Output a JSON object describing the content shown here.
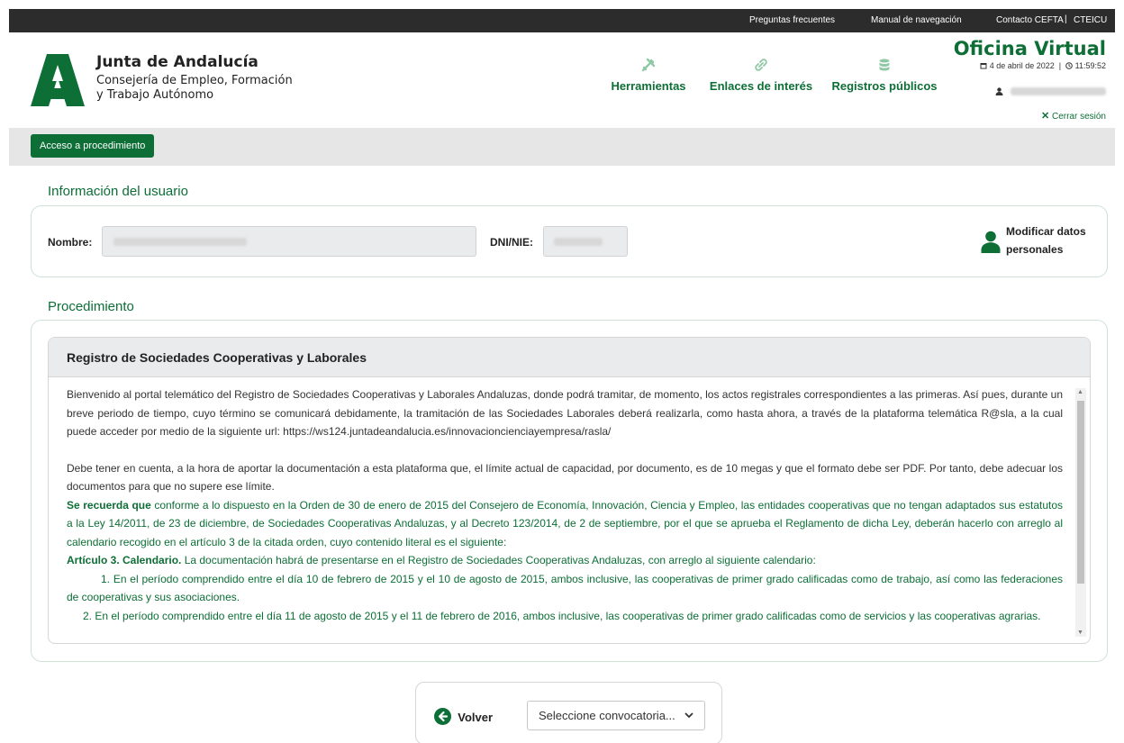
{
  "topbar": {
    "faq": "Preguntas frecuentes",
    "manual": "Manual de navegación",
    "contact": "Contacto CEFTA",
    "separator": "|",
    "cteicu": "CTEICU"
  },
  "header": {
    "org_title": "Junta de Andalucía",
    "org_sub_line1": "Consejería de Empleo, Formación",
    "org_sub_line2": "y Trabajo Autónomo",
    "nav": [
      {
        "label": "Herramientas",
        "icon": "tools-icon"
      },
      {
        "label": "Enlaces de interés",
        "icon": "link-icon"
      },
      {
        "label": "Registros públicos",
        "icon": "database-icon"
      }
    ],
    "office_title": "Oficina Virtual",
    "date": "4 de abril de 2022",
    "time": "11:59:52",
    "logout": "Cerrar sesión"
  },
  "toolbar": {
    "access_button": "Acceso a procedimiento"
  },
  "user_info": {
    "section_title": "Información del usuario",
    "name_label": "Nombre:",
    "dni_label": "DNI/NIE:",
    "modify_line1": "Modificar datos",
    "modify_line2": "personales"
  },
  "procedure": {
    "section_title": "Procedimiento",
    "panel_title": "Registro de Sociedades Cooperativas y Laborales",
    "p1": "Bienvenido al portal telemático del Registro de Sociedades Cooperativas y Laborales Andaluzas, donde podrá tramitar, de momento, los actos registrales correspondientes a las primeras. Así pues, durante un breve periodo de tiempo, cuyo término se comunicará debidamente, la tramitación de las Sociedades Laborales deberá realizarla, como hasta ahora, a través de la plataforma telemática R@sla, a la cual puede acceder por medio de la siguiente url: https://ws124.juntadeandalucia.es/innovacioncienciayempresa/rasla/",
    "p2": "Debe tener en cuenta, a la hora de aportar la documentación a esta plataforma que, el límite actual de capacidad, por documento, es de 10 megas y que el formato debe ser PDF. Por tanto, debe adecuar los documentos para que no supere ese límite.",
    "p3_bold": "Se recuerda que",
    "p3_rest": " conforme a lo dispuesto en la Orden de 30 de enero de 2015 del Consejero de Economía, Innovación, Ciencia y Empleo, las entidades cooperativas que no tengan adaptados sus estatutos a la Ley 14/2011, de 23 de diciembre, de Sociedades Cooperativas Andaluzas, y al Decreto 123/2014, de 2 de septiembre, por el que se aprueba el Reglamento de dicha Ley, deberán hacerlo con arreglo al calendario recogido en el artículo 3 de la citada orden, cuyo contenido literal es el siguiente:",
    "p4_bold": "Artículo 3. Calendario.",
    "p4_rest": " La documentación habrá de presentarse en el Registro de Sociedades Cooperativas Andaluzas, con arreglo al siguiente calendario:",
    "p5": "1. En el período comprendido entre el día 10 de febrero de 2015 y el 10 de agosto de 2015, ambos inclusive, las cooperativas de primer grado calificadas como de trabajo, así como las federaciones de cooperativas y sus asociaciones.",
    "p6": "2. En el período comprendido entre el día 11 de agosto de 2015 y el 11 de febrero de 2016, ambos inclusive, las cooperativas de primer grado calificadas como de servicios y las cooperativas agrarias."
  },
  "footer": {
    "back": "Volver",
    "select_placeholder": "Seleccione convocatoria..."
  },
  "colors": {
    "brand_green": "#0d6e36",
    "topbar": "#2c2c2c"
  }
}
